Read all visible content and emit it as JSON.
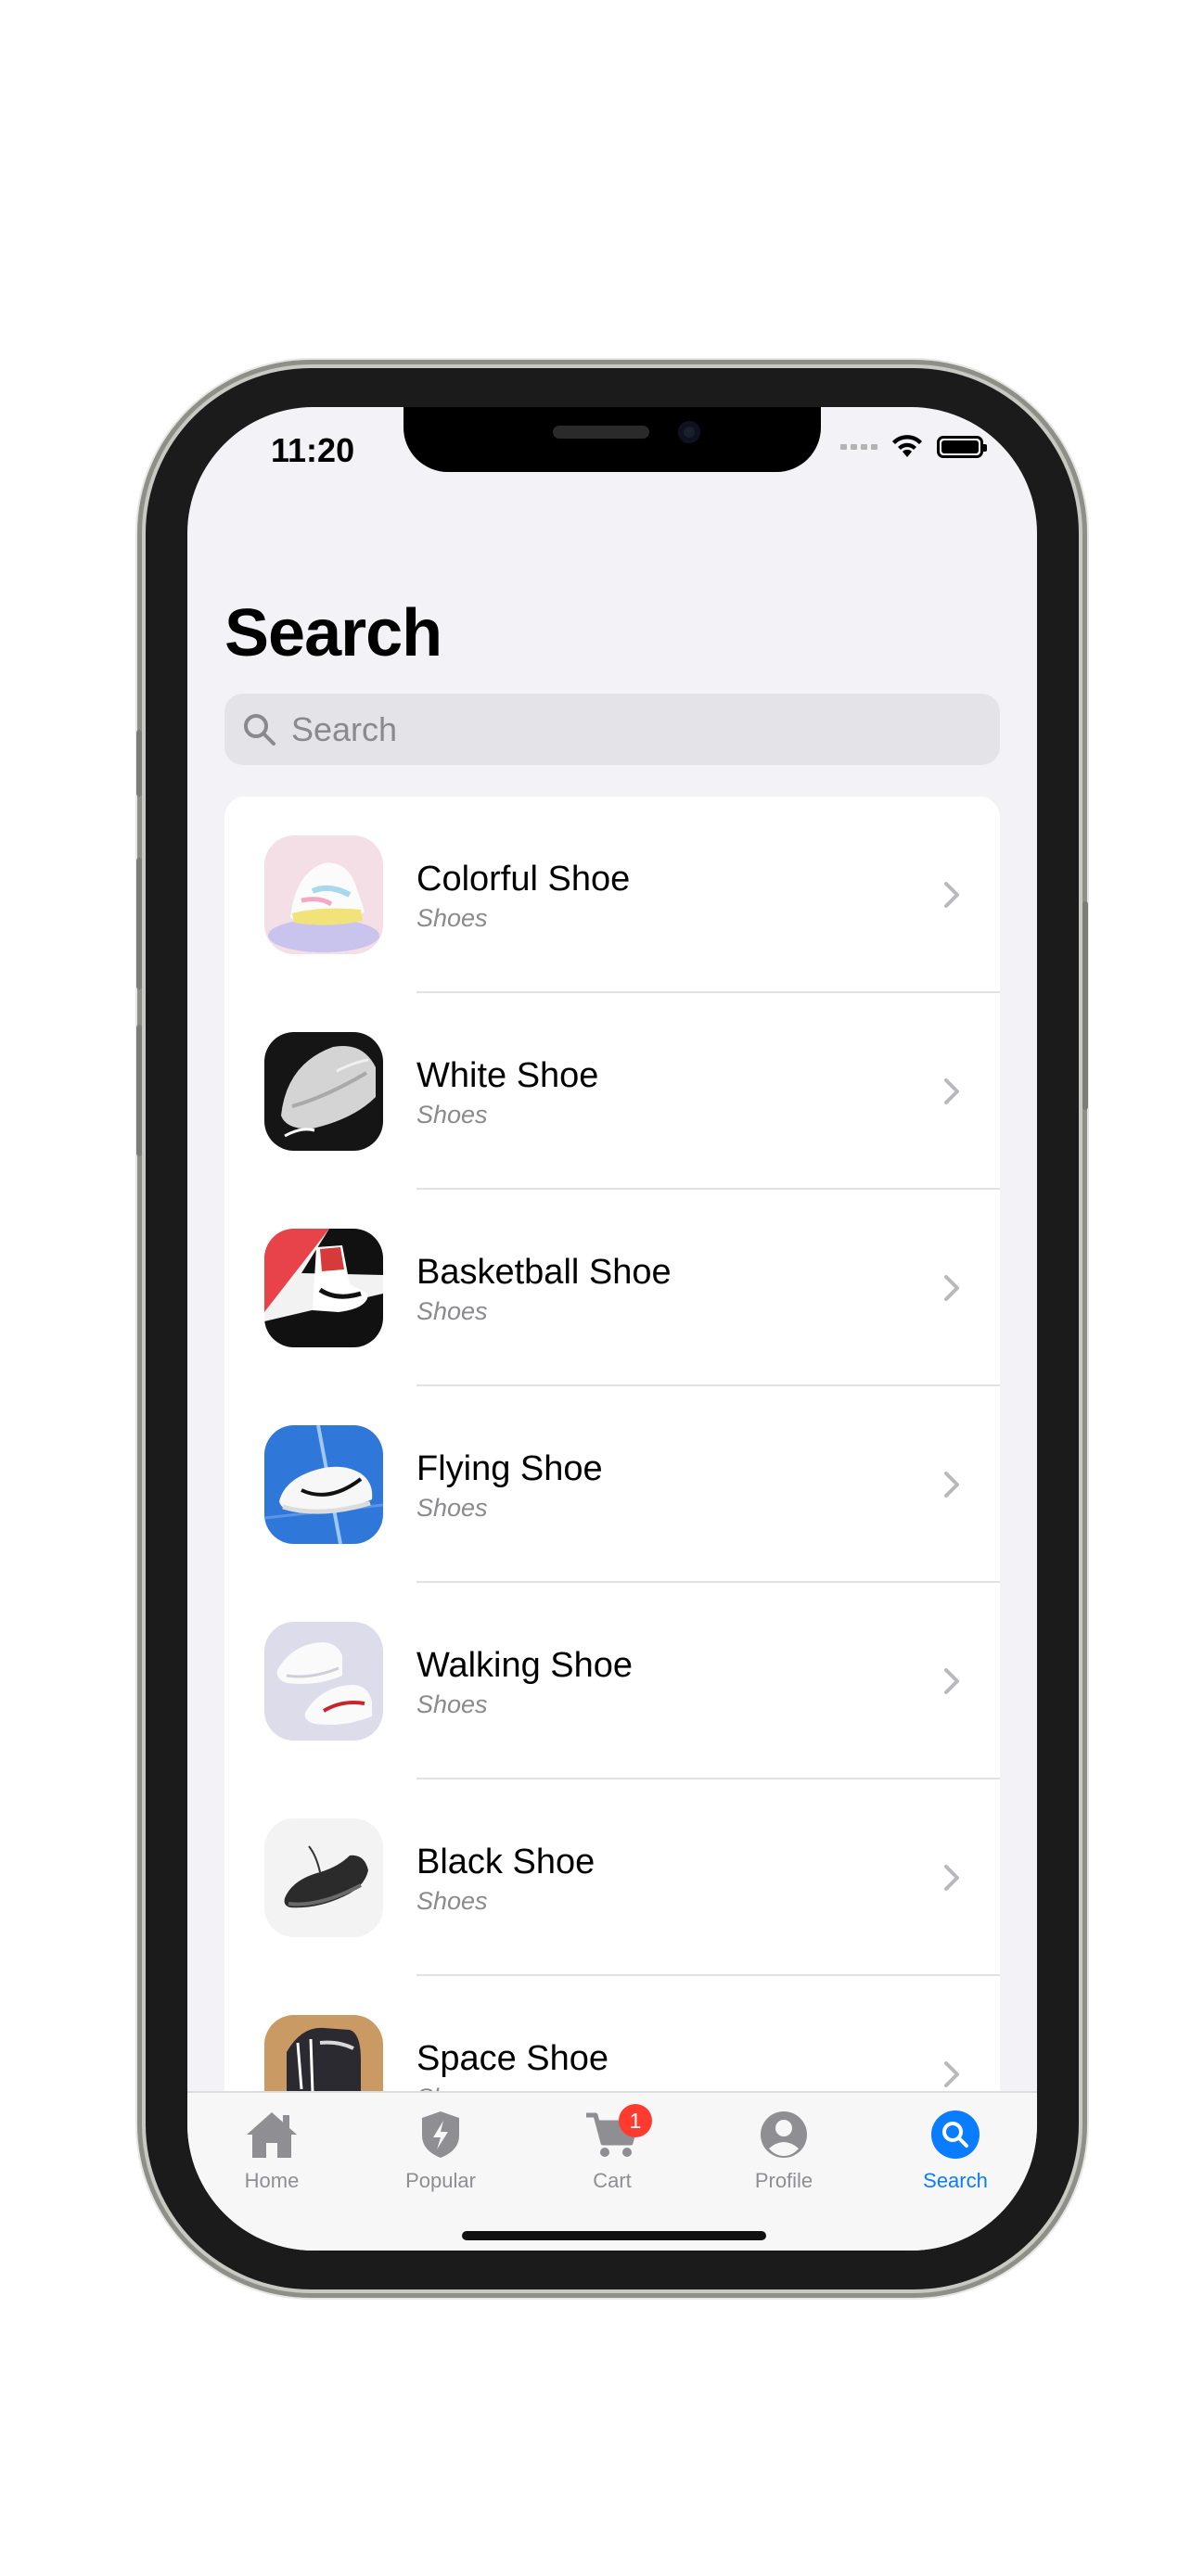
{
  "status_bar": {
    "time": "11:20"
  },
  "page": {
    "title": "Search"
  },
  "search": {
    "placeholder": "Search"
  },
  "products": [
    {
      "name": "Colorful Shoe",
      "category": "Shoes",
      "icon": "colorful-shoe-thumbnail"
    },
    {
      "name": "White Shoe",
      "category": "Shoes",
      "icon": "white-shoe-thumbnail"
    },
    {
      "name": "Basketball Shoe",
      "category": "Shoes",
      "icon": "basketball-shoe-thumbnail"
    },
    {
      "name": "Flying Shoe",
      "category": "Shoes",
      "icon": "flying-shoe-thumbnail"
    },
    {
      "name": "Walking Shoe",
      "category": "Shoes",
      "icon": "walking-shoe-thumbnail"
    },
    {
      "name": "Black Shoe",
      "category": "Shoes",
      "icon": "black-shoe-thumbnail"
    },
    {
      "name": "Space Shoe",
      "category": "Shoes",
      "icon": "space-shoe-thumbnail"
    }
  ],
  "tabbar": {
    "home": {
      "label": "Home",
      "icon": "house-icon"
    },
    "popular": {
      "label": "Popular",
      "icon": "bolt-shield-icon"
    },
    "cart": {
      "label": "Cart",
      "icon": "cart-icon",
      "badge": "1"
    },
    "profile": {
      "label": "Profile",
      "icon": "person-circle-icon"
    },
    "search": {
      "label": "Search",
      "icon": "search-circle-icon",
      "active": true
    }
  },
  "colors": {
    "accent": "#0a7cff",
    "badge": "#ff3b30",
    "background": "#f2f2f7"
  }
}
